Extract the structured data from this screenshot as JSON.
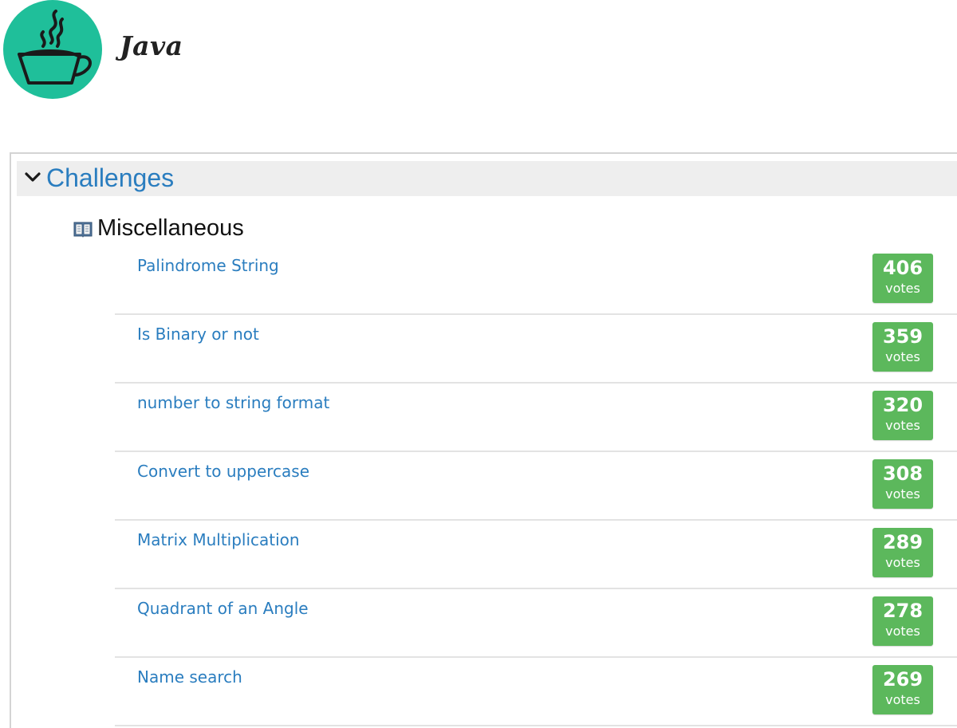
{
  "header": {
    "title": "Java",
    "logo_icon": "coffee-cup-icon",
    "logo_color": "#1fbf9a"
  },
  "section": {
    "title": "Challenges",
    "expand_icon": "chevron-down-icon"
  },
  "category": {
    "title": "Miscellaneous",
    "icon": "book-icon"
  },
  "challenges": [
    {
      "title": "Palindrome String",
      "votes": "406",
      "votes_label": "votes"
    },
    {
      "title": "Is Binary or not",
      "votes": "359",
      "votes_label": "votes"
    },
    {
      "title": "number to string format",
      "votes": "320",
      "votes_label": "votes"
    },
    {
      "title": "Convert to uppercase",
      "votes": "308",
      "votes_label": "votes"
    },
    {
      "title": "Matrix Multiplication",
      "votes": "289",
      "votes_label": "votes"
    },
    {
      "title": "Quadrant of an Angle",
      "votes": "278",
      "votes_label": "votes"
    },
    {
      "title": "Name search",
      "votes": "269",
      "votes_label": "votes"
    }
  ],
  "colors": {
    "link": "#2a7dbf",
    "badge": "#5cb85c",
    "header_bg": "#eeeeee"
  }
}
